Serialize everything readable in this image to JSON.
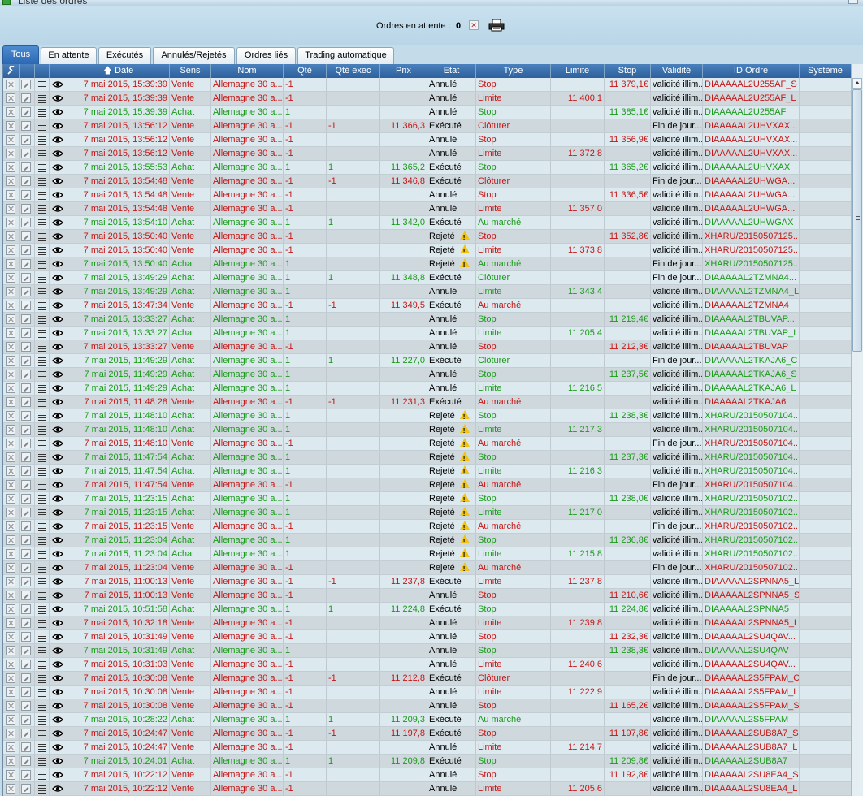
{
  "window": {
    "title": "Liste des ordres"
  },
  "header": {
    "pending_label": "Ordres en attente :",
    "pending_count": "0"
  },
  "tabs": [
    {
      "label": "Tous",
      "active": true
    },
    {
      "label": "En attente"
    },
    {
      "label": "Exécutés"
    },
    {
      "label": "Annulés/Rejetés"
    },
    {
      "label": "Ordres liés"
    },
    {
      "label": "Trading automatique"
    }
  ],
  "columns": [
    "",
    "",
    "",
    "",
    "Date",
    "Sens",
    "Nom",
    "Qté",
    "Qté exec",
    "Prix",
    "Etat",
    "Type",
    "Limite",
    "Stop",
    "Validité",
    "ID Ordre",
    "Système"
  ],
  "colors": {
    "buy": "#1a9a1a",
    "sell": "#c41616",
    "header": "#2d609c"
  },
  "icons": [
    "delete-icon",
    "edit-icon",
    "details-icon",
    "view-icon",
    "printer-icon",
    "sort-arrow-icon",
    "warning-icon"
  ],
  "rows": [
    {
      "date": "7 mai 2015, 15:39:39",
      "sens": "Vente",
      "nom": "Allemagne 30 a...",
      "qte": "-1",
      "qte_exec": "",
      "prix": "",
      "etat": "Annulé",
      "warn": false,
      "type": "Stop",
      "limite": "",
      "stop": "11 379,1€",
      "validite": "validité illim...",
      "id": "DIAAAAAL2U255AF_S"
    },
    {
      "date": "7 mai 2015, 15:39:39",
      "sens": "Vente",
      "nom": "Allemagne 30 a...",
      "qte": "-1",
      "qte_exec": "",
      "prix": "",
      "etat": "Annulé",
      "warn": false,
      "type": "Limite",
      "limite": "11 400,1",
      "stop": "",
      "validite": "validité illim...",
      "id": "DIAAAAAL2U255AF_L"
    },
    {
      "date": "7 mai 2015, 15:39:39",
      "sens": "Achat",
      "nom": "Allemagne 30 a...",
      "qte": "1",
      "qte_exec": "",
      "prix": "",
      "etat": "Annulé",
      "warn": false,
      "type": "Stop",
      "limite": "",
      "stop": "11 385,1€",
      "validite": "validité illim...",
      "id": "DIAAAAAL2U255AF"
    },
    {
      "date": "7 mai 2015, 13:56:12",
      "sens": "Vente",
      "nom": "Allemagne 30 a...",
      "qte": "-1",
      "qte_exec": "-1",
      "prix": "11 366,3",
      "etat": "Exécuté",
      "warn": false,
      "type": "Clôturer",
      "limite": "",
      "stop": "",
      "validite": "Fin de jour...",
      "id": "DIAAAAAL2UHVXAX..."
    },
    {
      "date": "7 mai 2015, 13:56:12",
      "sens": "Vente",
      "nom": "Allemagne 30 a...",
      "qte": "-1",
      "qte_exec": "",
      "prix": "",
      "etat": "Annulé",
      "warn": false,
      "type": "Stop",
      "limite": "",
      "stop": "11 356,9€",
      "validite": "validité illim...",
      "id": "DIAAAAAL2UHVXAX..."
    },
    {
      "date": "7 mai 2015, 13:56:12",
      "sens": "Vente",
      "nom": "Allemagne 30 a...",
      "qte": "-1",
      "qte_exec": "",
      "prix": "",
      "etat": "Annulé",
      "warn": false,
      "type": "Limite",
      "limite": "11 372,8",
      "stop": "",
      "validite": "validité illim...",
      "id": "DIAAAAAL2UHVXAX..."
    },
    {
      "date": "7 mai 2015, 13:55:53",
      "sens": "Achat",
      "nom": "Allemagne 30 a...",
      "qte": "1",
      "qte_exec": "1",
      "prix": "11 365,2",
      "etat": "Exécuté",
      "warn": false,
      "type": "Stop",
      "limite": "",
      "stop": "11 365,2€",
      "validite": "validité illim...",
      "id": "DIAAAAAL2UHVXAX"
    },
    {
      "date": "7 mai 2015, 13:54:48",
      "sens": "Vente",
      "nom": "Allemagne 30 a...",
      "qte": "-1",
      "qte_exec": "-1",
      "prix": "11 346,8",
      "etat": "Exécuté",
      "warn": false,
      "type": "Clôturer",
      "limite": "",
      "stop": "",
      "validite": "Fin de jour...",
      "id": "DIAAAAAL2UHWGA..."
    },
    {
      "date": "7 mai 2015, 13:54:48",
      "sens": "Vente",
      "nom": "Allemagne 30 a...",
      "qte": "-1",
      "qte_exec": "",
      "prix": "",
      "etat": "Annulé",
      "warn": false,
      "type": "Stop",
      "limite": "",
      "stop": "11 336,5€",
      "validite": "validité illim...",
      "id": "DIAAAAAL2UHWGA..."
    },
    {
      "date": "7 mai 2015, 13:54:48",
      "sens": "Vente",
      "nom": "Allemagne 30 a...",
      "qte": "-1",
      "qte_exec": "",
      "prix": "",
      "etat": "Annulé",
      "warn": false,
      "type": "Limite",
      "limite": "11 357,0",
      "stop": "",
      "validite": "validité illim...",
      "id": "DIAAAAAL2UHWGA..."
    },
    {
      "date": "7 mai 2015, 13:54:10",
      "sens": "Achat",
      "nom": "Allemagne 30 a...",
      "qte": "1",
      "qte_exec": "1",
      "prix": "11 342,0",
      "etat": "Exécuté",
      "warn": false,
      "type": "Au marché",
      "limite": "",
      "stop": "",
      "validite": "validité illim...",
      "id": "DIAAAAAL2UHWGAX"
    },
    {
      "date": "7 mai 2015, 13:50:40",
      "sens": "Vente",
      "nom": "Allemagne 30 a...",
      "qte": "-1",
      "qte_exec": "",
      "prix": "",
      "etat": "Rejeté",
      "warn": true,
      "type": "Stop",
      "limite": "",
      "stop": "11 352,8€",
      "validite": "validité illim...",
      "id": "XHARU/20150507125..."
    },
    {
      "date": "7 mai 2015, 13:50:40",
      "sens": "Vente",
      "nom": "Allemagne 30 a...",
      "qte": "-1",
      "qte_exec": "",
      "prix": "",
      "etat": "Rejeté",
      "warn": true,
      "type": "Limite",
      "limite": "11 373,8",
      "stop": "",
      "validite": "validité illim...",
      "id": "XHARU/20150507125..."
    },
    {
      "date": "7 mai 2015, 13:50:40",
      "sens": "Achat",
      "nom": "Allemagne 30 a...",
      "qte": "1",
      "qte_exec": "",
      "prix": "",
      "etat": "Rejeté",
      "warn": true,
      "type": "Au marché",
      "limite": "",
      "stop": "",
      "validite": "Fin de jour...",
      "id": "XHARU/20150507125..."
    },
    {
      "date": "7 mai 2015, 13:49:29",
      "sens": "Achat",
      "nom": "Allemagne 30 a...",
      "qte": "1",
      "qte_exec": "1",
      "prix": "11 348,8",
      "etat": "Exécuté",
      "warn": false,
      "type": "Clôturer",
      "limite": "",
      "stop": "",
      "validite": "Fin de jour...",
      "id": "DIAAAAAL2TZMNA4..."
    },
    {
      "date": "7 mai 2015, 13:49:29",
      "sens": "Achat",
      "nom": "Allemagne 30 a...",
      "qte": "1",
      "qte_exec": "",
      "prix": "",
      "etat": "Annulé",
      "warn": false,
      "type": "Limite",
      "limite": "11 343,4",
      "stop": "",
      "validite": "validité illim...",
      "id": "DIAAAAAL2TZMNA4_L"
    },
    {
      "date": "7 mai 2015, 13:47:34",
      "sens": "Vente",
      "nom": "Allemagne 30 a...",
      "qte": "-1",
      "qte_exec": "-1",
      "prix": "11 349,5",
      "etat": "Exécuté",
      "warn": false,
      "type": "Au marché",
      "limite": "",
      "stop": "",
      "validite": "validité illim...",
      "id": "DIAAAAAL2TZMNA4"
    },
    {
      "date": "7 mai 2015, 13:33:27",
      "sens": "Achat",
      "nom": "Allemagne 30 a...",
      "qte": "1",
      "qte_exec": "",
      "prix": "",
      "etat": "Annulé",
      "warn": false,
      "type": "Stop",
      "limite": "",
      "stop": "11 219,4€",
      "validite": "validité illim...",
      "id": "DIAAAAAL2TBUVAP..."
    },
    {
      "date": "7 mai 2015, 13:33:27",
      "sens": "Achat",
      "nom": "Allemagne 30 a...",
      "qte": "1",
      "qte_exec": "",
      "prix": "",
      "etat": "Annulé",
      "warn": false,
      "type": "Limite",
      "limite": "11 205,4",
      "stop": "",
      "validite": "validité illim...",
      "id": "DIAAAAAL2TBUVAP_L"
    },
    {
      "date": "7 mai 2015, 13:33:27",
      "sens": "Vente",
      "nom": "Allemagne 30 a...",
      "qte": "-1",
      "qte_exec": "",
      "prix": "",
      "etat": "Annulé",
      "warn": false,
      "type": "Stop",
      "limite": "",
      "stop": "11 212,3€",
      "validite": "validité illim...",
      "id": "DIAAAAAL2TBUVAP"
    },
    {
      "date": "7 mai 2015, 11:49:29",
      "sens": "Achat",
      "nom": "Allemagne 30 a...",
      "qte": "1",
      "qte_exec": "1",
      "prix": "11 227,0",
      "etat": "Exécuté",
      "warn": false,
      "type": "Clôturer",
      "limite": "",
      "stop": "",
      "validite": "Fin de jour...",
      "id": "DIAAAAAL2TKAJA6_C"
    },
    {
      "date": "7 mai 2015, 11:49:29",
      "sens": "Achat",
      "nom": "Allemagne 30 a...",
      "qte": "1",
      "qte_exec": "",
      "prix": "",
      "etat": "Annulé",
      "warn": false,
      "type": "Stop",
      "limite": "",
      "stop": "11 237,5€",
      "validite": "validité illim...",
      "id": "DIAAAAAL2TKAJA6_S"
    },
    {
      "date": "7 mai 2015, 11:49:29",
      "sens": "Achat",
      "nom": "Allemagne 30 a...",
      "qte": "1",
      "qte_exec": "",
      "prix": "",
      "etat": "Annulé",
      "warn": false,
      "type": "Limite",
      "limite": "11 216,5",
      "stop": "",
      "validite": "validité illim...",
      "id": "DIAAAAAL2TKAJA6_L"
    },
    {
      "date": "7 mai 2015, 11:48:28",
      "sens": "Vente",
      "nom": "Allemagne 30 a...",
      "qte": "-1",
      "qte_exec": "-1",
      "prix": "11 231,3",
      "etat": "Exécuté",
      "warn": false,
      "type": "Au marché",
      "limite": "",
      "stop": "",
      "validite": "validité illim...",
      "id": "DIAAAAAL2TKAJA6"
    },
    {
      "date": "7 mai 2015, 11:48:10",
      "sens": "Achat",
      "nom": "Allemagne 30 a...",
      "qte": "1",
      "qte_exec": "",
      "prix": "",
      "etat": "Rejeté",
      "warn": true,
      "type": "Stop",
      "limite": "",
      "stop": "11 238,3€",
      "validite": "validité illim...",
      "id": "XHARU/20150507104..."
    },
    {
      "date": "7 mai 2015, 11:48:10",
      "sens": "Achat",
      "nom": "Allemagne 30 a...",
      "qte": "1",
      "qte_exec": "",
      "prix": "",
      "etat": "Rejeté",
      "warn": true,
      "type": "Limite",
      "limite": "11 217,3",
      "stop": "",
      "validite": "validité illim...",
      "id": "XHARU/20150507104..."
    },
    {
      "date": "7 mai 2015, 11:48:10",
      "sens": "Vente",
      "nom": "Allemagne 30 a...",
      "qte": "-1",
      "qte_exec": "",
      "prix": "",
      "etat": "Rejeté",
      "warn": true,
      "type": "Au marché",
      "limite": "",
      "stop": "",
      "validite": "Fin de jour...",
      "id": "XHARU/20150507104..."
    },
    {
      "date": "7 mai 2015, 11:47:54",
      "sens": "Achat",
      "nom": "Allemagne 30 a...",
      "qte": "1",
      "qte_exec": "",
      "prix": "",
      "etat": "Rejeté",
      "warn": true,
      "type": "Stop",
      "limite": "",
      "stop": "11 237,3€",
      "validite": "validité illim...",
      "id": "XHARU/20150507104..."
    },
    {
      "date": "7 mai 2015, 11:47:54",
      "sens": "Achat",
      "nom": "Allemagne 30 a...",
      "qte": "1",
      "qte_exec": "",
      "prix": "",
      "etat": "Rejeté",
      "warn": true,
      "type": "Limite",
      "limite": "11 216,3",
      "stop": "",
      "validite": "validité illim...",
      "id": "XHARU/20150507104..."
    },
    {
      "date": "7 mai 2015, 11:47:54",
      "sens": "Vente",
      "nom": "Allemagne 30 a...",
      "qte": "-1",
      "qte_exec": "",
      "prix": "",
      "etat": "Rejeté",
      "warn": true,
      "type": "Au marché",
      "limite": "",
      "stop": "",
      "validite": "Fin de jour...",
      "id": "XHARU/20150507104..."
    },
    {
      "date": "7 mai 2015, 11:23:15",
      "sens": "Achat",
      "nom": "Allemagne 30 a...",
      "qte": "1",
      "qte_exec": "",
      "prix": "",
      "etat": "Rejeté",
      "warn": true,
      "type": "Stop",
      "limite": "",
      "stop": "11 238,0€",
      "validite": "validité illim...",
      "id": "XHARU/20150507102..."
    },
    {
      "date": "7 mai 2015, 11:23:15",
      "sens": "Achat",
      "nom": "Allemagne 30 a...",
      "qte": "1",
      "qte_exec": "",
      "prix": "",
      "etat": "Rejeté",
      "warn": true,
      "type": "Limite",
      "limite": "11 217,0",
      "stop": "",
      "validite": "validité illim...",
      "id": "XHARU/20150507102..."
    },
    {
      "date": "7 mai 2015, 11:23:15",
      "sens": "Vente",
      "nom": "Allemagne 30 a...",
      "qte": "-1",
      "qte_exec": "",
      "prix": "",
      "etat": "Rejeté",
      "warn": true,
      "type": "Au marché",
      "limite": "",
      "stop": "",
      "validite": "Fin de jour...",
      "id": "XHARU/20150507102..."
    },
    {
      "date": "7 mai 2015, 11:23:04",
      "sens": "Achat",
      "nom": "Allemagne 30 a...",
      "qte": "1",
      "qte_exec": "",
      "prix": "",
      "etat": "Rejeté",
      "warn": true,
      "type": "Stop",
      "limite": "",
      "stop": "11 236,8€",
      "validite": "validité illim...",
      "id": "XHARU/20150507102..."
    },
    {
      "date": "7 mai 2015, 11:23:04",
      "sens": "Achat",
      "nom": "Allemagne 30 a...",
      "qte": "1",
      "qte_exec": "",
      "prix": "",
      "etat": "Rejeté",
      "warn": true,
      "type": "Limite",
      "limite": "11 215,8",
      "stop": "",
      "validite": "validité illim...",
      "id": "XHARU/20150507102..."
    },
    {
      "date": "7 mai 2015, 11:23:04",
      "sens": "Vente",
      "nom": "Allemagne 30 a...",
      "qte": "-1",
      "qte_exec": "",
      "prix": "",
      "etat": "Rejeté",
      "warn": true,
      "type": "Au marché",
      "limite": "",
      "stop": "",
      "validite": "Fin de jour...",
      "id": "XHARU/20150507102..."
    },
    {
      "date": "7 mai 2015, 11:00:13",
      "sens": "Vente",
      "nom": "Allemagne 30 a...",
      "qte": "-1",
      "qte_exec": "-1",
      "prix": "11 237,8",
      "etat": "Exécuté",
      "warn": false,
      "type": "Limite",
      "limite": "11 237,8",
      "stop": "",
      "validite": "validité illim...",
      "id": "DIAAAAAL2SPNNA5_L"
    },
    {
      "date": "7 mai 2015, 11:00:13",
      "sens": "Vente",
      "nom": "Allemagne 30 a...",
      "qte": "-1",
      "qte_exec": "",
      "prix": "",
      "etat": "Annulé",
      "warn": false,
      "type": "Stop",
      "limite": "",
      "stop": "11 210,6€",
      "validite": "validité illim...",
      "id": "DIAAAAAL2SPNNA5_S"
    },
    {
      "date": "7 mai 2015, 10:51:58",
      "sens": "Achat",
      "nom": "Allemagne 30 a...",
      "qte": "1",
      "qte_exec": "1",
      "prix": "11 224,8",
      "etat": "Exécuté",
      "warn": false,
      "type": "Stop",
      "limite": "",
      "stop": "11 224,8€",
      "validite": "validité illim...",
      "id": "DIAAAAAL2SPNNA5"
    },
    {
      "date": "7 mai 2015, 10:32:18",
      "sens": "Vente",
      "nom": "Allemagne 30 a...",
      "qte": "-1",
      "qte_exec": "",
      "prix": "",
      "etat": "Annulé",
      "warn": false,
      "type": "Limite",
      "limite": "11 239,8",
      "stop": "",
      "validite": "validité illim...",
      "id": "DIAAAAAL2SPNNA5_L"
    },
    {
      "date": "7 mai 2015, 10:31:49",
      "sens": "Vente",
      "nom": "Allemagne 30 a...",
      "qte": "-1",
      "qte_exec": "",
      "prix": "",
      "etat": "Annulé",
      "warn": false,
      "type": "Stop",
      "limite": "",
      "stop": "11 232,3€",
      "validite": "validité illim...",
      "id": "DIAAAAAL2SU4QAV..."
    },
    {
      "date": "7 mai 2015, 10:31:49",
      "sens": "Achat",
      "nom": "Allemagne 30 a...",
      "qte": "1",
      "qte_exec": "",
      "prix": "",
      "etat": "Annulé",
      "warn": false,
      "type": "Stop",
      "limite": "",
      "stop": "11 238,3€",
      "validite": "validité illim...",
      "id": "DIAAAAAL2SU4QAV"
    },
    {
      "date": "7 mai 2015, 10:31:03",
      "sens": "Vente",
      "nom": "Allemagne 30 a...",
      "qte": "-1",
      "qte_exec": "",
      "prix": "",
      "etat": "Annulé",
      "warn": false,
      "type": "Limite",
      "limite": "11 240,6",
      "stop": "",
      "validite": "validité illim...",
      "id": "DIAAAAAL2SU4QAV..."
    },
    {
      "date": "7 mai 2015, 10:30:08",
      "sens": "Vente",
      "nom": "Allemagne 30 a...",
      "qte": "-1",
      "qte_exec": "-1",
      "prix": "11 212,8",
      "etat": "Exécuté",
      "warn": false,
      "type": "Clôturer",
      "limite": "",
      "stop": "",
      "validite": "Fin de jour...",
      "id": "DIAAAAAL2S5FPAM_C"
    },
    {
      "date": "7 mai 2015, 10:30:08",
      "sens": "Vente",
      "nom": "Allemagne 30 a...",
      "qte": "-1",
      "qte_exec": "",
      "prix": "",
      "etat": "Annulé",
      "warn": false,
      "type": "Limite",
      "limite": "11 222,9",
      "stop": "",
      "validite": "validité illim...",
      "id": "DIAAAAAL2S5FPAM_L"
    },
    {
      "date": "7 mai 2015, 10:30:08",
      "sens": "Vente",
      "nom": "Allemagne 30 a...",
      "qte": "-1",
      "qte_exec": "",
      "prix": "",
      "etat": "Annulé",
      "warn": false,
      "type": "Stop",
      "limite": "",
      "stop": "11 165,2€",
      "validite": "validité illim...",
      "id": "DIAAAAAL2S5FPAM_S"
    },
    {
      "date": "7 mai 2015, 10:28:22",
      "sens": "Achat",
      "nom": "Allemagne 30 a...",
      "qte": "1",
      "qte_exec": "1",
      "prix": "11 209,3",
      "etat": "Exécuté",
      "warn": false,
      "type": "Au marché",
      "limite": "",
      "stop": "",
      "validite": "validité illim...",
      "id": "DIAAAAAL2S5FPAM"
    },
    {
      "date": "7 mai 2015, 10:24:47",
      "sens": "Vente",
      "nom": "Allemagne 30 a...",
      "qte": "-1",
      "qte_exec": "-1",
      "prix": "11 197,8",
      "etat": "Exécuté",
      "warn": false,
      "type": "Stop",
      "limite": "",
      "stop": "11 197,8€",
      "validite": "validité illim...",
      "id": "DIAAAAAL2SUB8A7_S"
    },
    {
      "date": "7 mai 2015, 10:24:47",
      "sens": "Vente",
      "nom": "Allemagne 30 a...",
      "qte": "-1",
      "qte_exec": "",
      "prix": "",
      "etat": "Annulé",
      "warn": false,
      "type": "Limite",
      "limite": "11 214,7",
      "stop": "",
      "validite": "validité illim...",
      "id": "DIAAAAAL2SUB8A7_L"
    },
    {
      "date": "7 mai 2015, 10:24:01",
      "sens": "Achat",
      "nom": "Allemagne 30 a...",
      "qte": "1",
      "qte_exec": "1",
      "prix": "11 209,8",
      "etat": "Exécuté",
      "warn": false,
      "type": "Stop",
      "limite": "",
      "stop": "11 209,8€",
      "validite": "validité illim...",
      "id": "DIAAAAAL2SUB8A7"
    },
    {
      "date": "7 mai 2015, 10:22:12",
      "sens": "Vente",
      "nom": "Allemagne 30 a...",
      "qte": "-1",
      "qte_exec": "",
      "prix": "",
      "etat": "Annulé",
      "warn": false,
      "type": "Stop",
      "limite": "",
      "stop": "11 192,8€",
      "validite": "validité illim...",
      "id": "DIAAAAAL2SU8EA4_S"
    },
    {
      "date": "7 mai 2015, 10:22:12",
      "sens": "Vente",
      "nom": "Allemagne 30 a...",
      "qte": "-1",
      "qte_exec": "",
      "prix": "",
      "etat": "Annulé",
      "warn": false,
      "type": "Limite",
      "limite": "11 205,6",
      "stop": "",
      "validite": "validité illim...",
      "id": "DIAAAAAL2SU8EA4_L"
    }
  ]
}
